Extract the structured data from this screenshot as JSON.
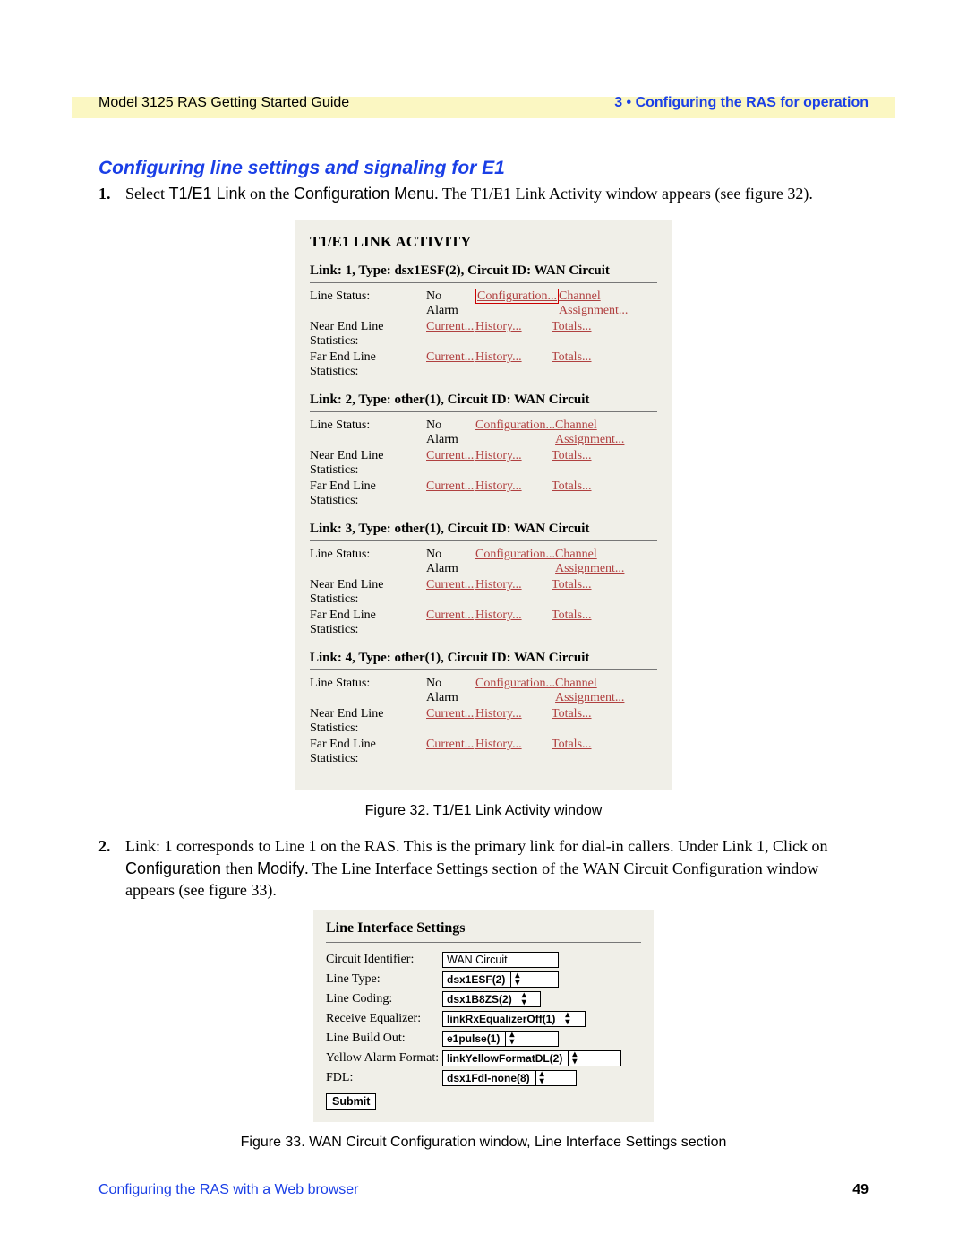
{
  "header": {
    "left": "Model 3125 RAS Getting Started Guide",
    "right": "3 • Configuring the RAS for operation"
  },
  "section_title": "Configuring line settings and signaling for E1",
  "steps": {
    "s1": {
      "num": "1.",
      "lead": "Select ",
      "link": "T1/E1 Link",
      "mid": " on the ",
      "cfgmenu": "Configuration Menu",
      "tail": ". The T1/E1 Link Activity window appears (see figure 32)."
    },
    "s2": {
      "num": "2.",
      "p1a": "Link: 1 corresponds to Line 1 on the RAS. This is the primary link for dial-in callers. Under Link 1, Click on ",
      "cfg": "Configuration",
      "then": " then ",
      "mod": "Modify",
      "p1b": ". The Line Interface Settings section of the WAN Circuit Configuration window appears (see figure 33)."
    }
  },
  "fig32": {
    "title": "T1/E1 LINK ACTIVITY",
    "caption": "Figure 32. T1/E1 Link Activity window",
    "blocks": [
      {
        "head": "Link: 1, Type: dsx1ESF(2), Circuit ID: WAN Circuit",
        "highlight_config": true
      },
      {
        "head": "Link: 2, Type: other(1), Circuit ID: WAN Circuit",
        "highlight_config": false
      },
      {
        "head": "Link: 3, Type: other(1), Circuit ID: WAN Circuit",
        "highlight_config": false
      },
      {
        "head": "Link: 4, Type: other(1), Circuit ID: WAN Circuit",
        "highlight_config": false
      }
    ],
    "labels": {
      "line_status": "Line Status:",
      "no_alarm": "No Alarm",
      "configuration": "Configuration...",
      "channel_assignment": "Channel Assignment...",
      "near": "Near End Line Statistics:",
      "far": "Far End Line Statistics:",
      "current": "Current...",
      "history": "History...",
      "totals": "Totals..."
    }
  },
  "fig33": {
    "title": "Line Interface Settings",
    "caption": "Figure 33. WAN Circuit Configuration window, Line Interface Settings section",
    "rows": {
      "circuit_id": {
        "label": "Circuit Identifier:",
        "value": "WAN Circuit"
      },
      "line_type": {
        "label": "Line Type:",
        "value": "dsx1ESF(2)"
      },
      "line_coding": {
        "label": "Line Coding:",
        "value": "dsx1B8ZS(2)"
      },
      "rx_eq": {
        "label": "Receive Equalizer:",
        "value": "linkRxEqualizerOff(1)"
      },
      "lbo": {
        "label": "Line Build Out:",
        "value": "e1pulse(1)"
      },
      "yellow": {
        "label": "Yellow Alarm Format:",
        "value": "linkYellowFormatDL(2)"
      },
      "fdl": {
        "label": "FDL:",
        "value": "dsx1Fdl-none(8)"
      }
    },
    "submit": "Submit"
  },
  "footer": {
    "left": "Configuring the RAS with a Web browser",
    "page": "49"
  }
}
